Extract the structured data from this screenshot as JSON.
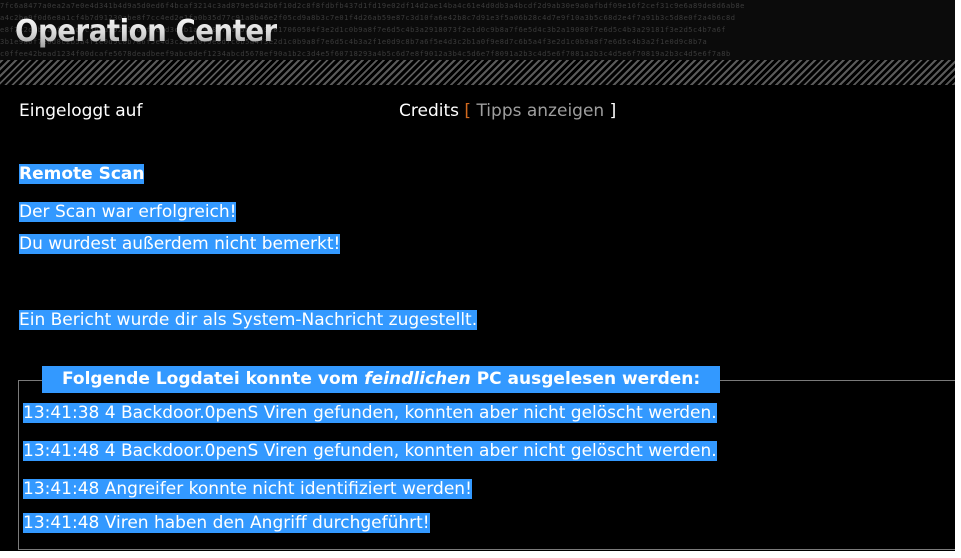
{
  "header": {
    "logo_text": "Operation Center",
    "noise_lines": [
      "7fc6a8477a0ea2a7e0e4d341b4d9a5d0ed6f4bcaf3214c3ad879e5d42b6f10d2c8f8fdbfb437d1fd19e02df14d2ae14ba4c61e4d0db3a4bcdf2d9ab30e9a0afbdf09e16f2cef31c9e6a89de8d6ab8e",
      "a4c2be9f0d6e8a1cf4b7d91230abe8f7cc4ed2e1fa0b35d77c91a8b46e2f05cd9a8b3c7e01f4d26ab59e87c3d10fa6e42b8c7d91e3f5a06b28c4d7e9f10a3b5c68d2e4f7a91b3c5d8e0f2a4b6c8d",
      "e8f7c2d1b0a9f8e7d6c5b4a39281706f5e4d3c2b1a09f8e7d6c5b4a392817060504f3e2d1c0b9a8f7e6d5c4b3a2918073f2e1d0c9b8a7f6e5d4c3b2a19080f7e6d5c4b3a29181f3e2d5c4b7a6f",
      "3b1e9a0f7e6d8c2b5a4f1e0d9c8b7a6f5e4d3c2b1a0f9e8d7c6b5a4f3e2d1c0b9a8f7e6d5c4b3a2f1e0d9c8b7a6f5e4d3c2b1a0f9e8d7c6b5a4f3e2d1c0b9a8f7e6d5c4b3a2f1e0d9c8b7a",
      "c0ffee42bead1234f00dcafe5678deadbeef9abc0def1234abcd5678ef90a1b2c3d4e5f60718293a4b5c6d7e8f9012a3b4c5d6e7f8091a2b3c4d5e6f7081a2b3c4d5e6f70819a2b3c4d5e6f7a8b"
    ]
  },
  "infobar": {
    "logged_in_label": "Eingeloggt auf",
    "credits_label": "Credits",
    "bracket_open": "[",
    "tips_link": "Tipps anzeigen",
    "bracket_close": "]"
  },
  "result": {
    "title": "Remote Scan",
    "line1": "Der Scan war erfolgreich!",
    "line2": "Du wurdest außerdem nicht bemerkt!",
    "report": "Ein Bericht wurde dir als System-Nachricht zugestellt."
  },
  "log": {
    "legend_prefix": "Folgende Logdatei konnte vom ",
    "legend_em": "feindlichen",
    "legend_suffix": " PC ausgelesen werden:",
    "lines": [
      "13:41:38 4 Backdoor.0penS Viren gefunden, konnten aber nicht gelöscht werden.",
      "13:41:48 4 Backdoor.0penS Viren gefunden, konnten aber nicht gelöscht werden.",
      "13:41:48 Angreifer konnte nicht identifiziert werden!",
      "13:41:48 Viren haben den Angriff durchgeführt!"
    ]
  },
  "colors": {
    "background": "#000000",
    "selection": "#3399ff",
    "bracket_accent": "#d2691e",
    "tips_link": "#9e9e9e"
  }
}
